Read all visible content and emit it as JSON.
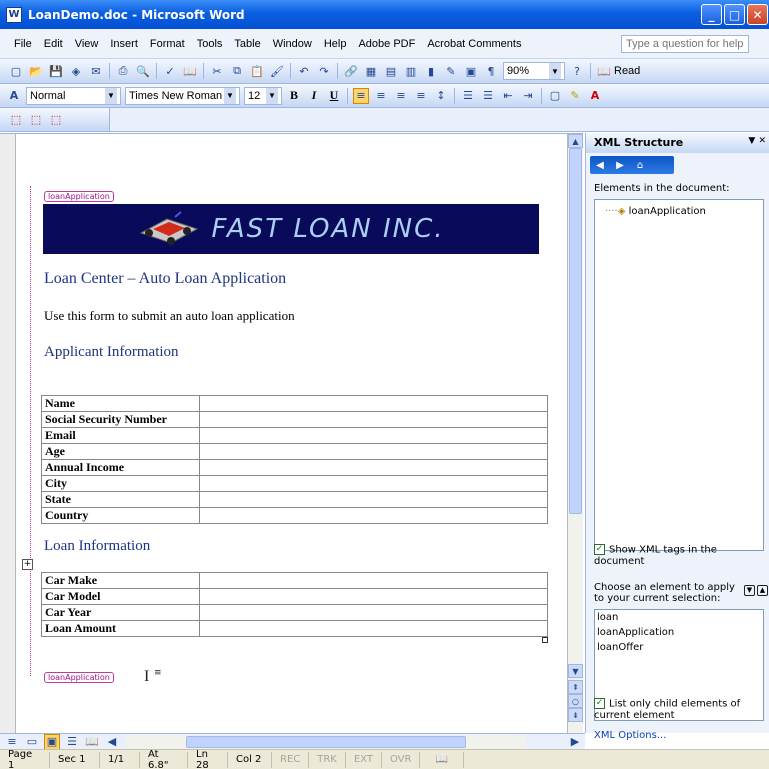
{
  "window": {
    "title": "LoanDemo.doc - Microsoft Word",
    "minimize": "_",
    "maximize": "□",
    "close": "✕"
  },
  "menu": {
    "items": [
      "File",
      "Edit",
      "View",
      "Insert",
      "Format",
      "Tools",
      "Table",
      "Window",
      "Help",
      "Adobe PDF",
      "Acrobat Comments"
    ],
    "ask_placeholder": "Type a question for help"
  },
  "toolbar": {
    "zoom": "90%",
    "read": "Read"
  },
  "format": {
    "style": "Normal",
    "font": "Times New Roman",
    "size": "12",
    "bold": "B",
    "italic": "I",
    "underline": "U"
  },
  "document": {
    "open_tag": "loanApplication",
    "close_tag": "loanApplication",
    "banner": "FAST LOAN INC.",
    "heading": "Loan Center – Auto Loan Application",
    "intro": "Use this form to submit an auto loan application",
    "section1": "Applicant Information",
    "applicant_fields": [
      "Name",
      "Social Security Number",
      "Email",
      "Age",
      "Annual Income",
      "City",
      "State",
      "Country"
    ],
    "section2": "Loan Information",
    "loan_fields": [
      "Car Make",
      "Car Model",
      "Car Year",
      "Loan Amount"
    ]
  },
  "xml_pane": {
    "title": "XML Structure",
    "elements_label": "Elements in the document:",
    "tree_root": "loanApplication",
    "show_tags_label": "Show XML tags in the document",
    "choose_label": "Choose an element to apply to your current selection:",
    "elements": [
      "loan",
      "loanApplication",
      "loanOffer"
    ],
    "list_only_label": "List only child elements of current element",
    "options_link": "XML Options..."
  },
  "status": {
    "page": "Page 1",
    "sec": "Sec 1",
    "pages": "1/1",
    "at": "At 6.8\"",
    "ln": "Ln 28",
    "col": "Col 2",
    "rec": "REC",
    "trk": "TRK",
    "ext": "EXT",
    "ovr": "OVR"
  }
}
